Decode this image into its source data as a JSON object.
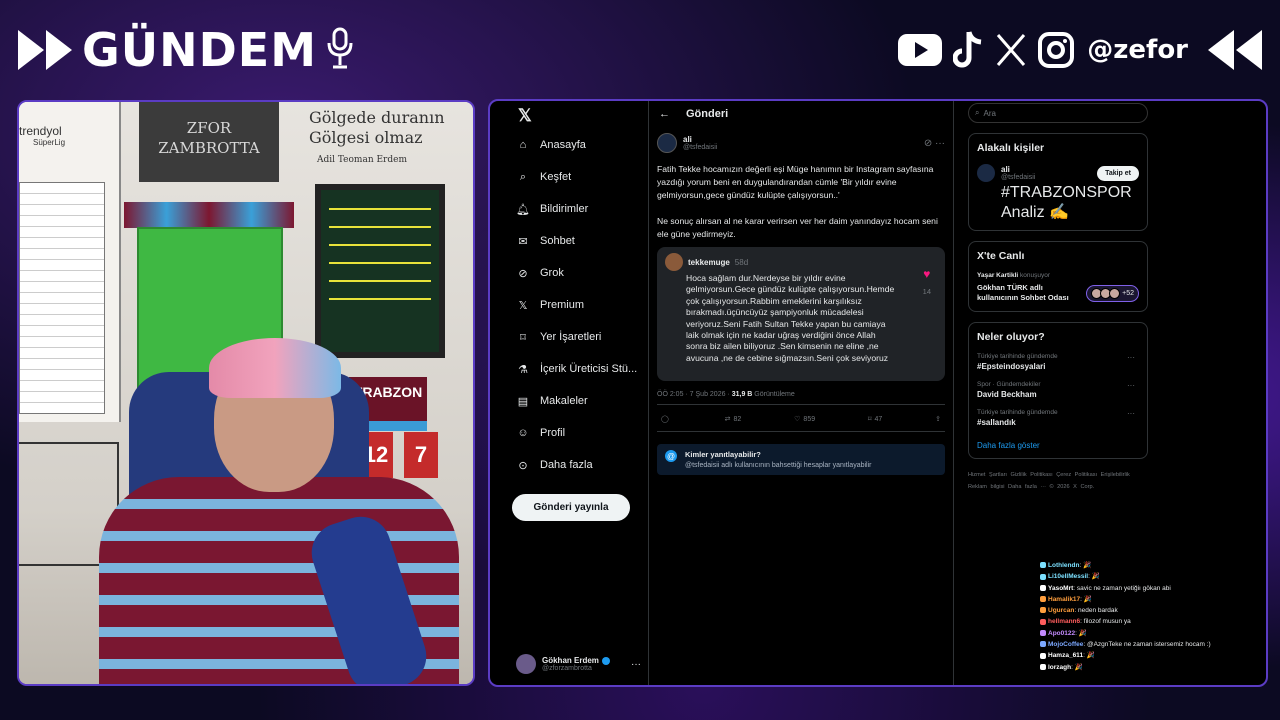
{
  "overlay": {
    "brand_title": "GÜNDEM",
    "handle": "@zefor",
    "social_icons": [
      "youtube-icon",
      "tiktok-icon",
      "x-icon",
      "instagram-icon"
    ],
    "brand_color": "#ffffff",
    "accent_border": "#5b3cc4"
  },
  "webcam": {
    "wall_sign_1": "ZFOR\nZAMBROTTA",
    "wall_sign_2": "Gölgede duranın\nGölgesi olmaz",
    "wall_sign_2_author": "Adil Teoman Erdem",
    "league_logo": "trendyol",
    "league_sub": "SüperLig",
    "badge_text": "TRABZON",
    "jersey_1": "12",
    "jersey_2": "7"
  },
  "x_nav": {
    "items": [
      {
        "label": "Anasayfa",
        "icon": "home-icon"
      },
      {
        "label": "Keşfet",
        "icon": "search-icon"
      },
      {
        "label": "Bildirimler",
        "icon": "bell-icon"
      },
      {
        "label": "Sohbet",
        "icon": "mail-icon"
      },
      {
        "label": "Grok",
        "icon": "grok-icon"
      },
      {
        "label": "Premium",
        "icon": "x-icon"
      },
      {
        "label": "Yer İşaretleri",
        "icon": "bookmark-icon"
      },
      {
        "label": "İçerik Üreticisi Stü...",
        "icon": "flask-icon"
      },
      {
        "label": "Makaleler",
        "icon": "article-icon"
      },
      {
        "label": "Profil",
        "icon": "user-icon"
      },
      {
        "label": "Daha fazla",
        "icon": "more-circle-icon"
      }
    ],
    "post_button": "Gönderi yayınla",
    "user_name": "Gökhan Erdem",
    "user_handle": "@zforzambrotta"
  },
  "x_main": {
    "header_title": "Gönderi",
    "tweet": {
      "author": "ali",
      "handle": "@tsfedaisii",
      "text": "Fatih Tekke hocamızın değerli eşi Müge hanımın bir Instagram sayfasına yazdığı yorum beni en duygulandırandan cümle 'Bir yıldır evine gelmiyorsun,gece gündüz kulüpte çalışıyorsun..'\n\nNe sonuç alırsan al ne karar verirsen ver her daim yanındayız hocam seni ele güne yedirmeyiz.",
      "quote": {
        "author": "tekkemuge",
        "time": "58d",
        "text": "Hoca sağlam dur.Nerdeyse bir yıldır evine gelmiyorsun.Gece gündüz kulüpte çalışıyorsun.Hemde çok çalışıyorsun.Rabbim emeklerini karşılıksız bırakmadı.üçüncüyüz şampiyonluk mücadelesi veriyoruz.Seni Fatih Sultan Tekke yapan bu camiaya laik olmak için ne kadar uğraş verdiğini önce Allah sonra biz ailen biliyoruz .Sen kimsenin ne eline ,ne avucuna ,ne de cebine sığmazsın.Seni çok seviyoruz",
        "likes": "14"
      },
      "meta_time": "ÖÖ 2:05 · 7 Şub 2026 · ",
      "meta_views": "31,9 B",
      "meta_views_label": " Görüntüleme",
      "actions": {
        "replies": "",
        "reposts": "82",
        "likes": "859",
        "bookmarks": "47"
      }
    },
    "reply_box": {
      "title": "Kimler yanıtlayabilir?",
      "subtitle": "@tsfedaisii adlı kullanıcının bahsettiği hesaplar yanıtlayabilir"
    }
  },
  "x_side": {
    "search_placeholder": "Ara",
    "related": {
      "title": "Alakalı kişiler",
      "name": "ali",
      "handle": "@tsfedaisii",
      "bio": "#TRABZONSPOR Analiz ✍",
      "follow_label": "Takip et"
    },
    "live": {
      "title": "X'te Canlı",
      "host": "Yaşar Kartikli",
      "host_suffix": " konuşuyor",
      "space_title": "Gökhan TÜRK adlı kullanıcının Sohbet Odası",
      "listener_count": "+52"
    },
    "trends": {
      "title": "Neler oluyor?",
      "items": [
        {
          "context": "Türkiye tarihinde gündemde",
          "name": "#Epsteindosyalari"
        },
        {
          "context": "Spor · Gündemdekiler",
          "name": "David Beckham"
        },
        {
          "context": "Türkiye tarihinde gündemde",
          "name": "#sallandık"
        }
      ],
      "more_label": "Daha fazla göster"
    },
    "footer": "Hizmet Şartları   Gizlilik Politikası   Çerez Politikası   Erişilebilirlik   Reklam bilgisi   Daha fazla ···   © 2026 X Corp."
  },
  "chat": {
    "header": "",
    "messages": [
      {
        "user": "Lothlendn",
        "text": ": 🎉",
        "color": "#7ce0ff"
      },
      {
        "user": "Li10ellMessil",
        "text": ": 🎉",
        "color": "#7ce0ff"
      },
      {
        "user": "YasoMrt",
        "text": ": savic ne zaman yetiğiı gökan abi",
        "color": "#ffffff"
      },
      {
        "user": "Hamalik17",
        "text": ": 🎉",
        "color": "#ff9e3d"
      },
      {
        "user": "Ugurcan",
        "text": ": neden bardak",
        "color": "#ff9e3d"
      },
      {
        "user": "hellmann6",
        "text": ": filozof musun ya",
        "color": "#ff5d5d"
      },
      {
        "user": "Apo0122",
        "text": ": 🎉",
        "color": "#c48bff"
      },
      {
        "user": "MojoCoffee",
        "text": ": @AzgnTeke ne zaman istersemiz hocam :)",
        "color": "#7ca8ff"
      },
      {
        "user": "Hamza_611",
        "text": ": 🎉",
        "color": "#ffffff"
      },
      {
        "user": "lorzagh",
        "text": ": 🎉",
        "color": "#ffffff"
      }
    ]
  }
}
